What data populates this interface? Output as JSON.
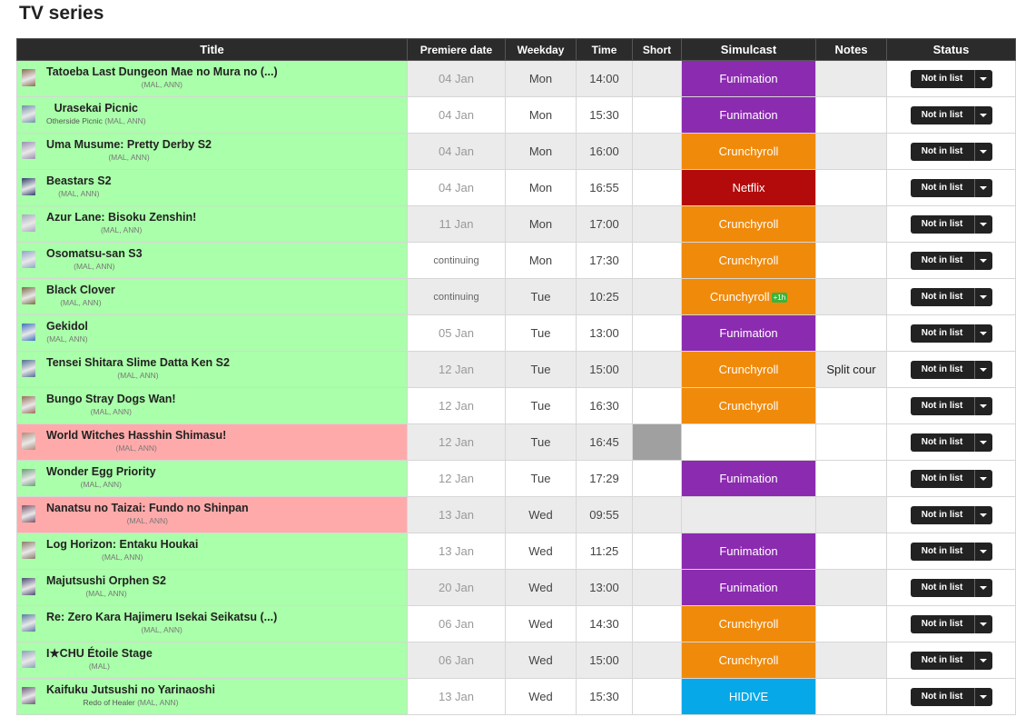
{
  "page": {
    "title": "TV series"
  },
  "columns": {
    "title": "Title",
    "premiere": "Premiere date",
    "weekday": "Weekday",
    "time": "Time",
    "short": "Short",
    "simulcast": "Simulcast",
    "notes": "Notes",
    "status": "Status"
  },
  "colors": {
    "green_row": "#aaffaa",
    "red_row": "#ffaaaa",
    "row_gray": "#ebebeb",
    "row_white": "#ffffff",
    "short_gray": "#a0a0a0",
    "Funimation": "#8b2bb0",
    "Crunchyroll": "#f08a0b",
    "Netflix": "#b30b0b",
    "HIDIVE": "#07a8e8"
  },
  "status_default": "Not in list",
  "rows": [
    {
      "title": "Tatoeba Last Dungeon Mae no Mura no (...)",
      "alt": "",
      "links": "(MAL, ANN)",
      "date": "04 Jan",
      "weekday": "Mon",
      "time": "14:00",
      "short": false,
      "simulcast": "Funimation",
      "badge": "",
      "notes": "",
      "color": "green",
      "thumb": "#8a6a55"
    },
    {
      "title": "Urasekai Picnic",
      "alt": "Otherside Picnic",
      "links": "(MAL, ANN)",
      "date": "04 Jan",
      "weekday": "Mon",
      "time": "15:30",
      "short": false,
      "simulcast": "Funimation",
      "badge": "",
      "notes": "",
      "color": "green",
      "thumb": "#6f8fa8"
    },
    {
      "title": "Uma Musume: Pretty Derby S2",
      "alt": "",
      "links": "(MAL, ANN)",
      "date": "04 Jan",
      "weekday": "Mon",
      "time": "16:00",
      "short": false,
      "simulcast": "Crunchyroll",
      "badge": "",
      "notes": "",
      "color": "green",
      "thumb": "#9a8fb0"
    },
    {
      "title": "Beastars S2",
      "alt": "",
      "links": "(MAL, ANN)",
      "date": "04 Jan",
      "weekday": "Mon",
      "time": "16:55",
      "short": false,
      "simulcast": "Netflix",
      "badge": "",
      "notes": "",
      "color": "green",
      "thumb": "#2c3e68"
    },
    {
      "title": "Azur Lane: Bisoku Zenshin!",
      "alt": "",
      "links": "(MAL, ANN)",
      "date": "11 Jan",
      "weekday": "Mon",
      "time": "17:00",
      "short": false,
      "simulcast": "Crunchyroll",
      "badge": "",
      "notes": "",
      "color": "green",
      "thumb": "#a7a9c0"
    },
    {
      "title": "Osomatsu-san S3",
      "alt": "",
      "links": "(MAL, ANN)",
      "date": "continuing",
      "weekday": "Mon",
      "time": "17:30",
      "short": false,
      "simulcast": "Crunchyroll",
      "badge": "",
      "notes": "",
      "color": "green",
      "thumb": "#8fa4c8"
    },
    {
      "title": "Black Clover",
      "alt": "",
      "links": "(MAL, ANN)",
      "date": "continuing",
      "weekday": "Tue",
      "time": "10:25",
      "short": false,
      "simulcast": "Crunchyroll",
      "badge": "+1h",
      "notes": "",
      "color": "green",
      "thumb": "#7a6a45"
    },
    {
      "title": "Gekidol",
      "alt": "",
      "links": "(MAL, ANN)",
      "date": "05 Jan",
      "weekday": "Tue",
      "time": "13:00",
      "short": false,
      "simulcast": "Funimation",
      "badge": "",
      "notes": "",
      "color": "green",
      "thumb": "#3f6fc0"
    },
    {
      "title": "Tensei Shitara Slime Datta Ken S2",
      "alt": "",
      "links": "(MAL, ANN)",
      "date": "12 Jan",
      "weekday": "Tue",
      "time": "15:00",
      "short": false,
      "simulcast": "Crunchyroll",
      "badge": "",
      "notes": "Split cour",
      "color": "green",
      "thumb": "#4f6d8f"
    },
    {
      "title": "Bungo Stray Dogs Wan!",
      "alt": "",
      "links": "(MAL, ANN)",
      "date": "12 Jan",
      "weekday": "Tue",
      "time": "16:30",
      "short": false,
      "simulcast": "Crunchyroll",
      "badge": "",
      "notes": "",
      "color": "green",
      "thumb": "#9a6b5a"
    },
    {
      "title": "World Witches Hasshin Shimasu!",
      "alt": "",
      "links": "(MAL, ANN)",
      "date": "12 Jan",
      "weekday": "Tue",
      "time": "16:45",
      "short": true,
      "simulcast": "",
      "badge": "",
      "notes": "",
      "color": "red",
      "thumb": "#b08a7a"
    },
    {
      "title": "Wonder Egg Priority",
      "alt": "",
      "links": "(MAL, ANN)",
      "date": "12 Jan",
      "weekday": "Tue",
      "time": "17:29",
      "short": false,
      "simulcast": "Funimation",
      "badge": "",
      "notes": "",
      "color": "green",
      "thumb": "#6a9a7a"
    },
    {
      "title": "Nanatsu no Taizai: Fundo no Shinpan",
      "alt": "",
      "links": "(MAL, ANN)",
      "date": "13 Jan",
      "weekday": "Wed",
      "time": "09:55",
      "short": false,
      "simulcast": "",
      "badge": "",
      "notes": "",
      "color": "red",
      "thumb": "#7a5068"
    },
    {
      "title": "Log Horizon: Entaku Houkai",
      "alt": "",
      "links": "(MAL, ANN)",
      "date": "13 Jan",
      "weekday": "Wed",
      "time": "11:25",
      "short": false,
      "simulcast": "Funimation",
      "badge": "",
      "notes": "",
      "color": "green",
      "thumb": "#8a7a68"
    },
    {
      "title": "Majutsushi Orphen S2",
      "alt": "",
      "links": "(MAL, ANN)",
      "date": "20 Jan",
      "weekday": "Wed",
      "time": "13:00",
      "short": false,
      "simulcast": "Funimation",
      "badge": "",
      "notes": "",
      "color": "green",
      "thumb": "#4a4a70"
    },
    {
      "title": "Re: Zero Kara Hajimeru Isekai Seikatsu (...)",
      "alt": "",
      "links": "(MAL, ANN)",
      "date": "06 Jan",
      "weekday": "Wed",
      "time": "14:30",
      "short": false,
      "simulcast": "Crunchyroll",
      "badge": "",
      "notes": "",
      "color": "green",
      "thumb": "#5a7aa0"
    },
    {
      "title": "I★CHU Étoile Stage",
      "alt": "",
      "links": "(MAL)",
      "date": "06 Jan",
      "weekday": "Wed",
      "time": "15:00",
      "short": false,
      "simulcast": "Crunchyroll",
      "badge": "",
      "notes": "",
      "color": "green",
      "thumb": "#8aa0b8"
    },
    {
      "title": "Kaifuku Jutsushi no Yarinaoshi",
      "alt": "Redo of Healer",
      "links": "(MAL, ANN)",
      "date": "13 Jan",
      "weekday": "Wed",
      "time": "15:30",
      "short": false,
      "simulcast": "HIDIVE",
      "badge": "",
      "notes": "",
      "color": "green",
      "thumb": "#6a5a78"
    }
  ]
}
